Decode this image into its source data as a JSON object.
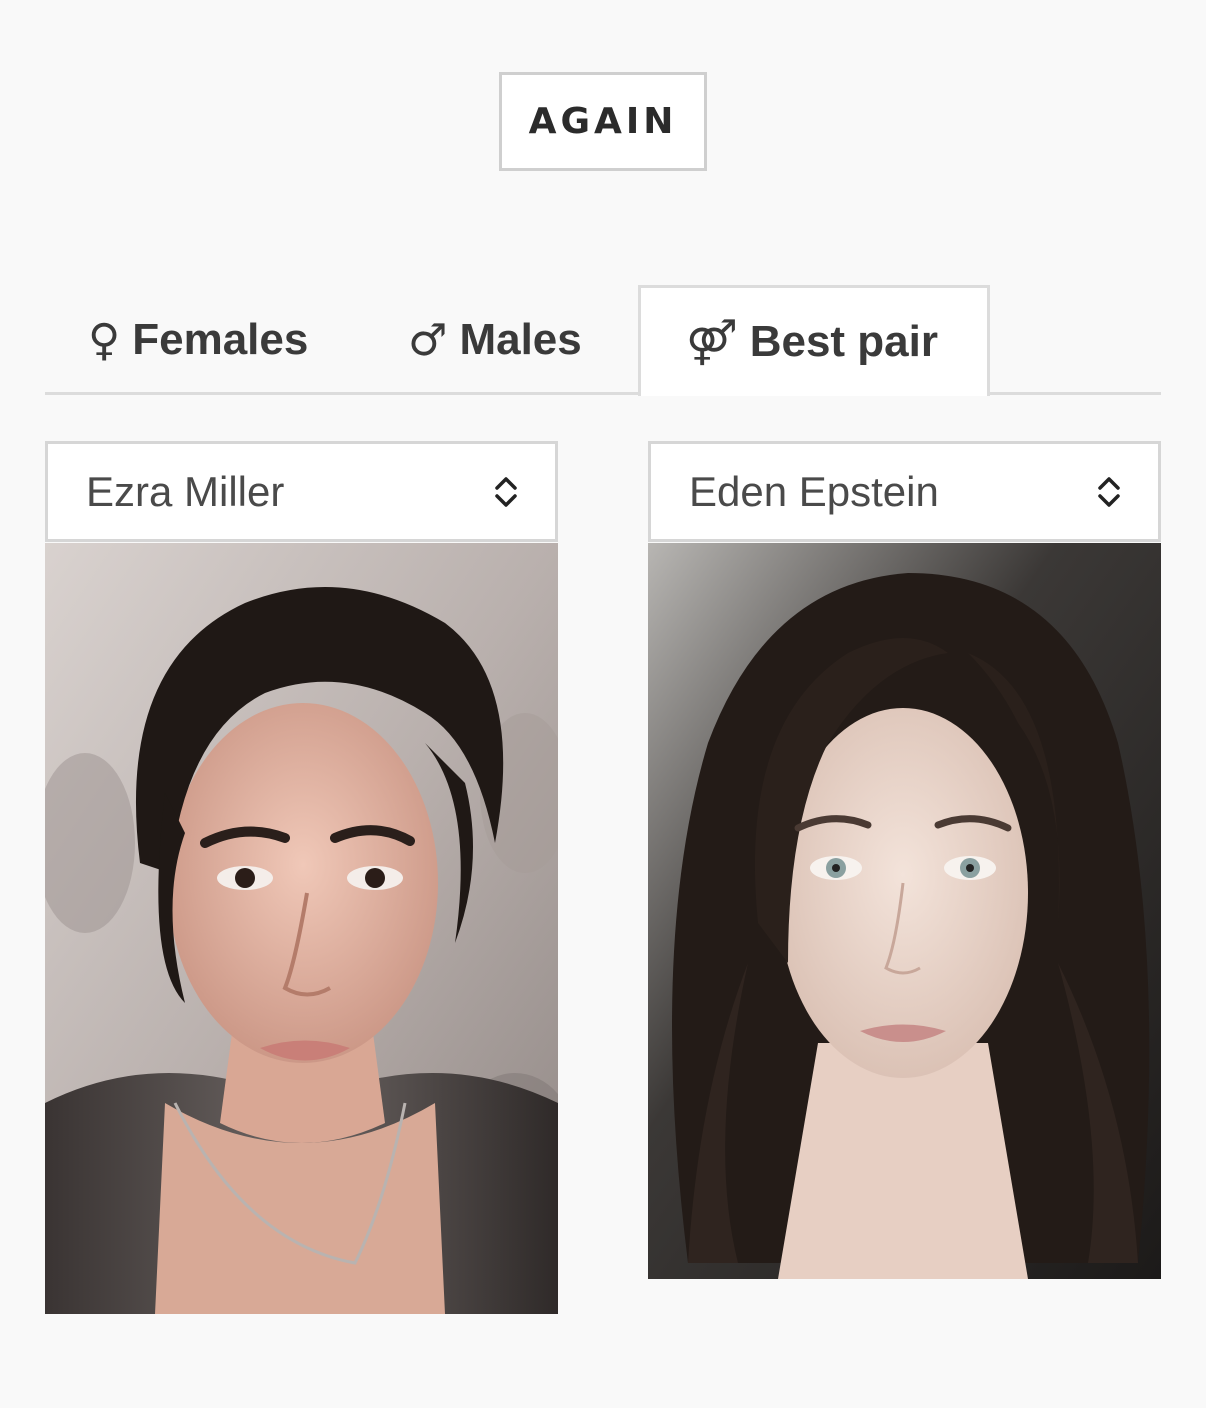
{
  "actions": {
    "again_label": "AGAIN"
  },
  "tabs": [
    {
      "icon": "female-icon",
      "symbol": "♀",
      "label": "Females"
    },
    {
      "icon": "male-icon",
      "symbol": "♂",
      "label": "Males"
    },
    {
      "icon": "pair-icon",
      "symbol": "⚤",
      "label": "Best pair",
      "active": true
    }
  ],
  "selectors": {
    "left": {
      "value": "Ezra Miller",
      "icon": "chevron-updown-icon"
    },
    "right": {
      "value": "Eden Epstein",
      "icon": "chevron-updown-icon"
    }
  },
  "colors": {
    "background": "#f9f9f9",
    "border": "#dcdcdc",
    "text": "#2f2f2f"
  }
}
